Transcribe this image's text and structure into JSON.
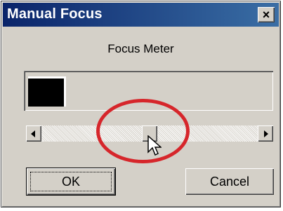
{
  "window": {
    "title": "Manual Focus",
    "close_label": "×"
  },
  "meter": {
    "label": "Focus Meter",
    "level": 0.15
  },
  "slider": {
    "position": 0.5
  },
  "buttons": {
    "ok": "OK",
    "cancel": "Cancel"
  }
}
